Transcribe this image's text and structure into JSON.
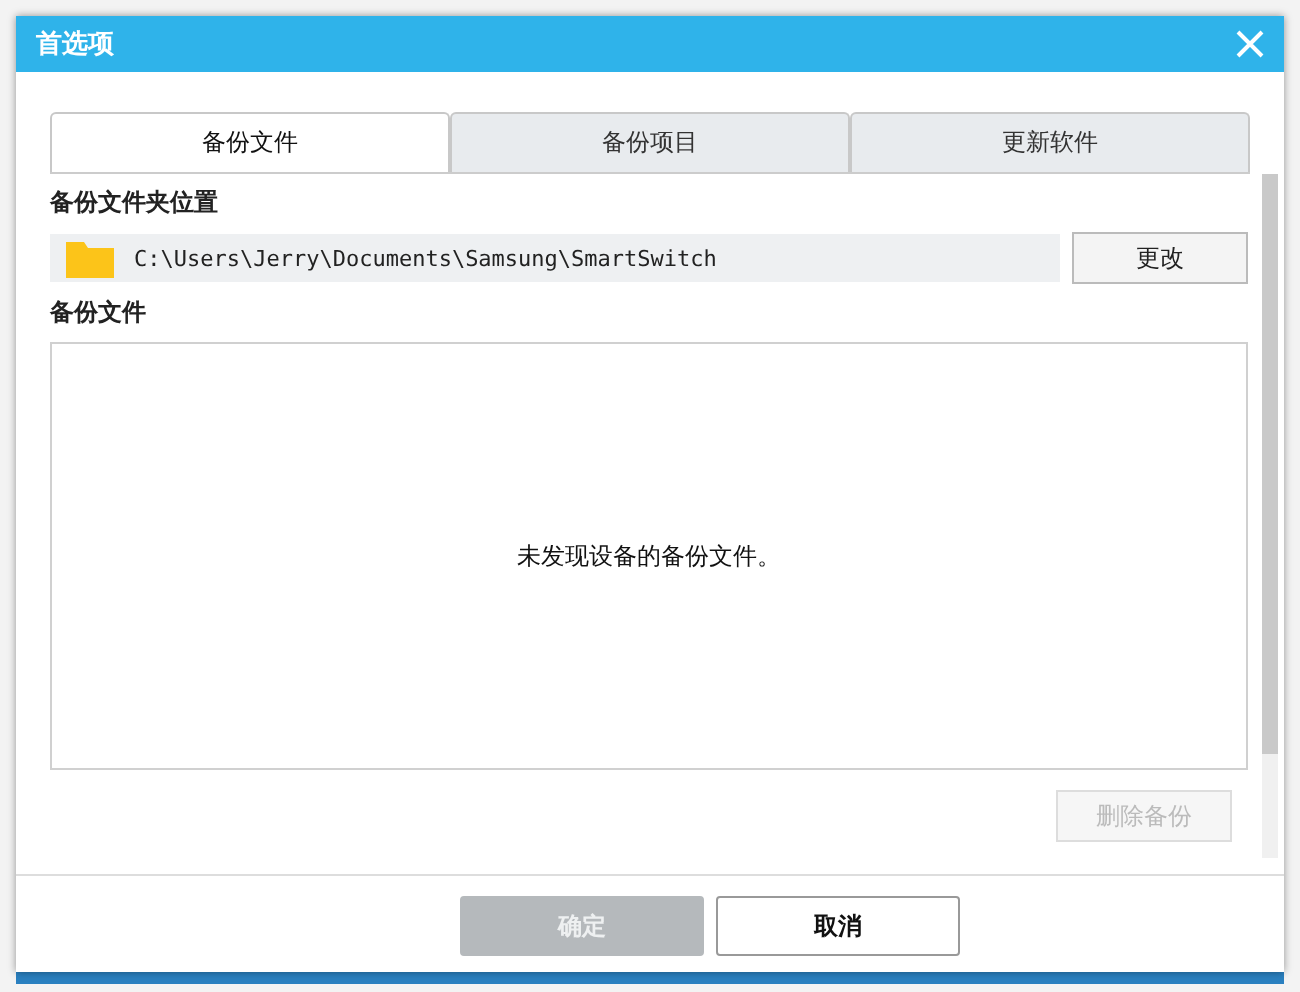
{
  "window": {
    "title": "首选项"
  },
  "tabs": [
    {
      "label": "备份文件",
      "selected": true
    },
    {
      "label": "备份项目",
      "selected": false
    },
    {
      "label": "更新软件",
      "selected": false
    }
  ],
  "folder_section": {
    "heading": "备份文件夹位置",
    "path": "C:\\Users\\Jerry\\Documents\\Samsung\\SmartSwitch",
    "change_button": "更改"
  },
  "backups_section": {
    "heading": "备份文件",
    "empty_message": "未发现设备的备份文件。",
    "delete_button": {
      "label": "删除备份",
      "disabled": true
    }
  },
  "buttons": [
    {
      "label": "确定",
      "disabled": true
    },
    {
      "label": "取消",
      "disabled": false
    }
  ]
}
